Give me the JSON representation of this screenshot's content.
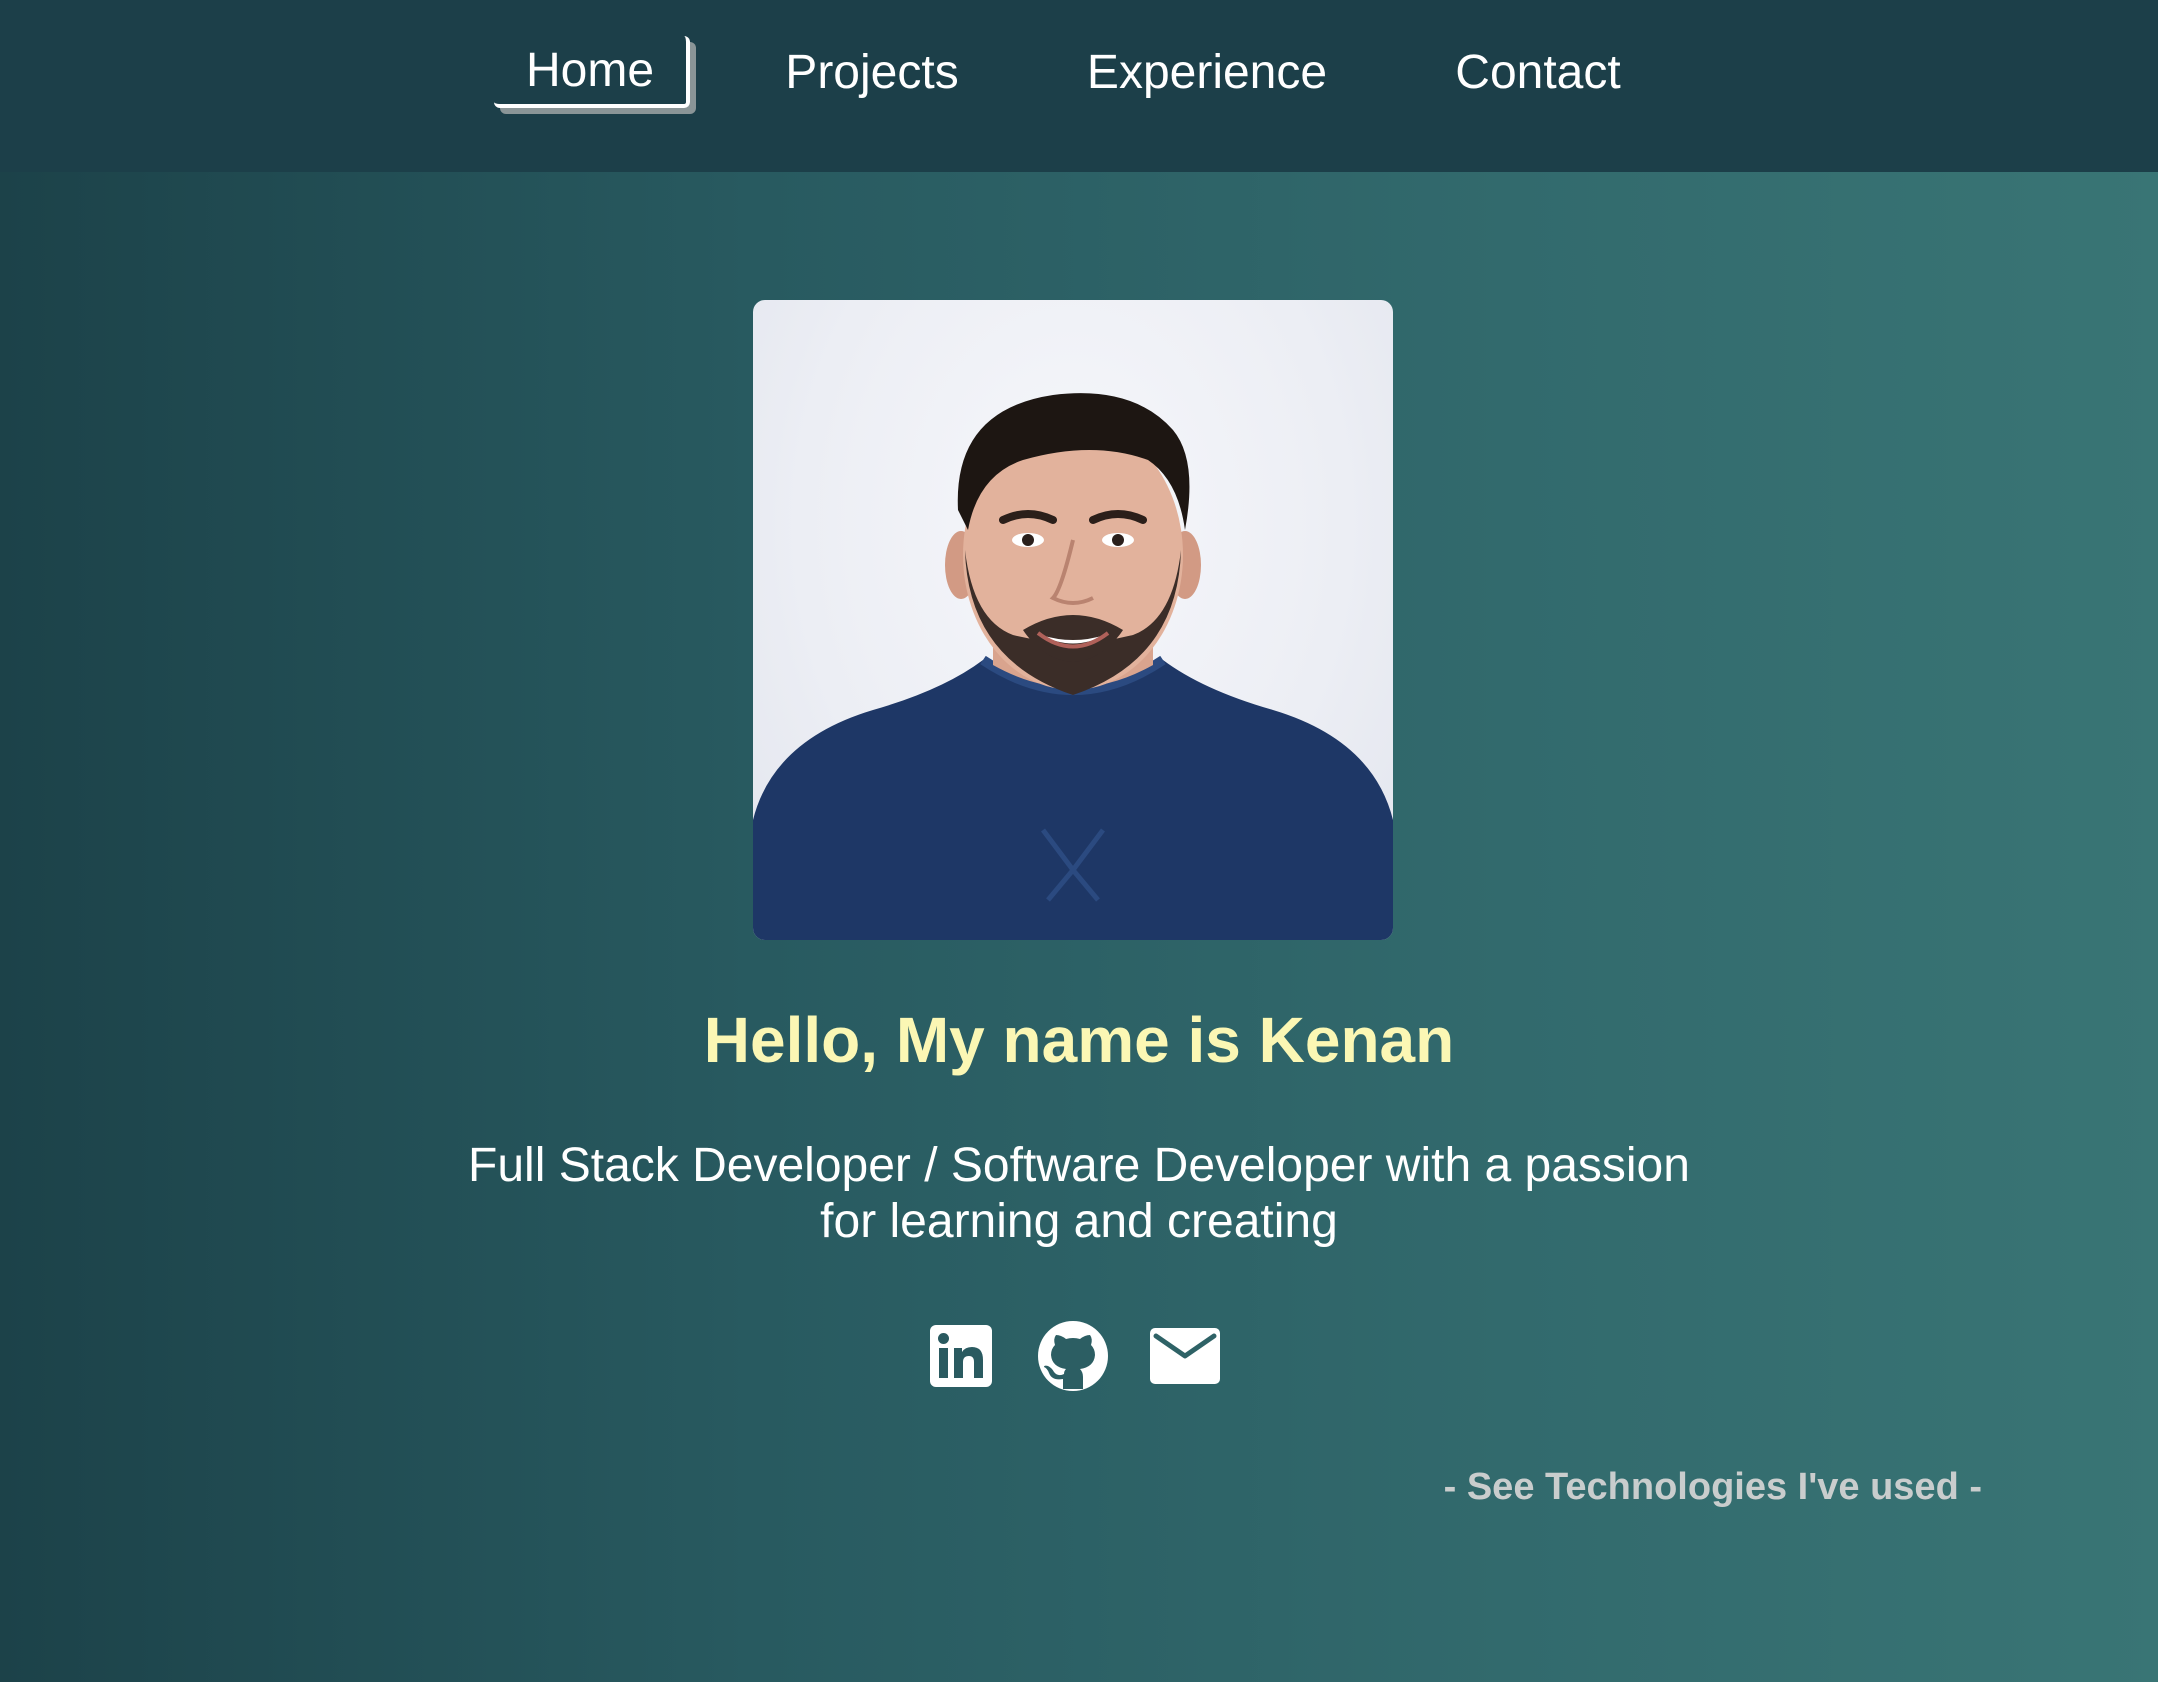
{
  "nav": {
    "items": [
      {
        "label": "Home",
        "active": true
      },
      {
        "label": "Projects",
        "active": false
      },
      {
        "label": "Experience",
        "active": false
      },
      {
        "label": "Contact",
        "active": false
      }
    ]
  },
  "hero": {
    "greeting": "Hello, My name is Kenan",
    "tagline_line1": "Full Stack Developer / Software Developer with a passion",
    "tagline_line2": "for learning and creating"
  },
  "socials": [
    {
      "icon": "linkedin-icon"
    },
    {
      "icon": "github-icon"
    },
    {
      "icon": "email-icon"
    }
  ],
  "tech_link": "- See Technologies I've used -",
  "colors": {
    "nav_bg": "#1c3f49",
    "greeting": "#fbf7b4",
    "text": "#ffffff",
    "tech_link": "#c9cdcd"
  }
}
